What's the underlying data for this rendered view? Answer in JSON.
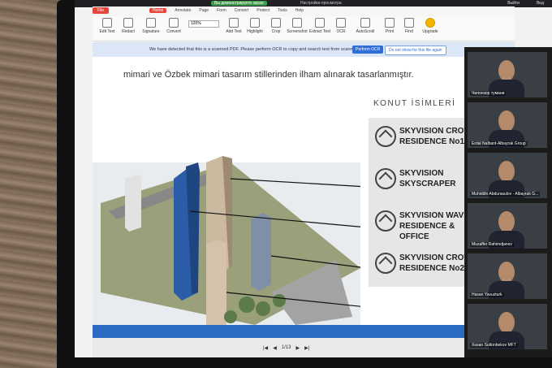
{
  "system_bar": {
    "share_tag": "Вы демонстрируете экран",
    "settings_label": "Настройки просмотра",
    "exit_label": "Выйти",
    "lang": "Вид"
  },
  "app": {
    "file_label": "File",
    "menu": [
      "Home",
      "Annotate",
      "Page",
      "Form",
      "Convert",
      "Protect",
      "Tools",
      "Help"
    ],
    "active_menu": "Home",
    "tools": [
      "Edit Text",
      "Redact",
      "Signature",
      "Convert",
      "Add Text",
      "Highlight",
      "Crop",
      "Screenshot",
      "Extract Text",
      "OCR",
      "AutoScroll",
      "Print",
      "Find",
      "Upgrade"
    ],
    "zoom": "120%"
  },
  "ocr_notice": {
    "message": "We have detected that this is a scanned PDF. Please perform OCR to copy and search text from scanned PDFs.",
    "perform_label": "Perform OCR",
    "dismiss_label": "Do not show for this file again"
  },
  "document": {
    "text_line": "mimari ve Özbek mimari tasarım stillerinden ilham alınarak tasarlanmıştır.",
    "section_title": "KONUT İSİMLERİ",
    "items": [
      {
        "line1": "SKYVISION CROWN",
        "line2": "RESIDENCE No1"
      },
      {
        "line1": "SKYVISION",
        "line2": "SKYSCRAPER"
      },
      {
        "line1": "SKYVISION WAVE",
        "line2": "RESIDENCE & OFFICE"
      },
      {
        "line1": "SKYVISION CROWN",
        "line2": "RESIDENCE No2"
      }
    ]
  },
  "page_nav": {
    "first": "|◀",
    "prev": "◀",
    "page": "1/13",
    "next": "▶",
    "last": "▶|"
  },
  "participants": [
    "Чилонзор тумани",
    "Erdal Nalbant-Albayrak Group",
    "Muhiddin Abdurasulov - Albayrak G...",
    "Muzaffer Rahimdjanov",
    "Hasan Yavuzturk",
    "Xusan Sultonbekov MFT"
  ],
  "colors": {
    "accent": "#e8463c",
    "ocr_button": "#2f6fd6",
    "facade": "#2a6bc4"
  }
}
